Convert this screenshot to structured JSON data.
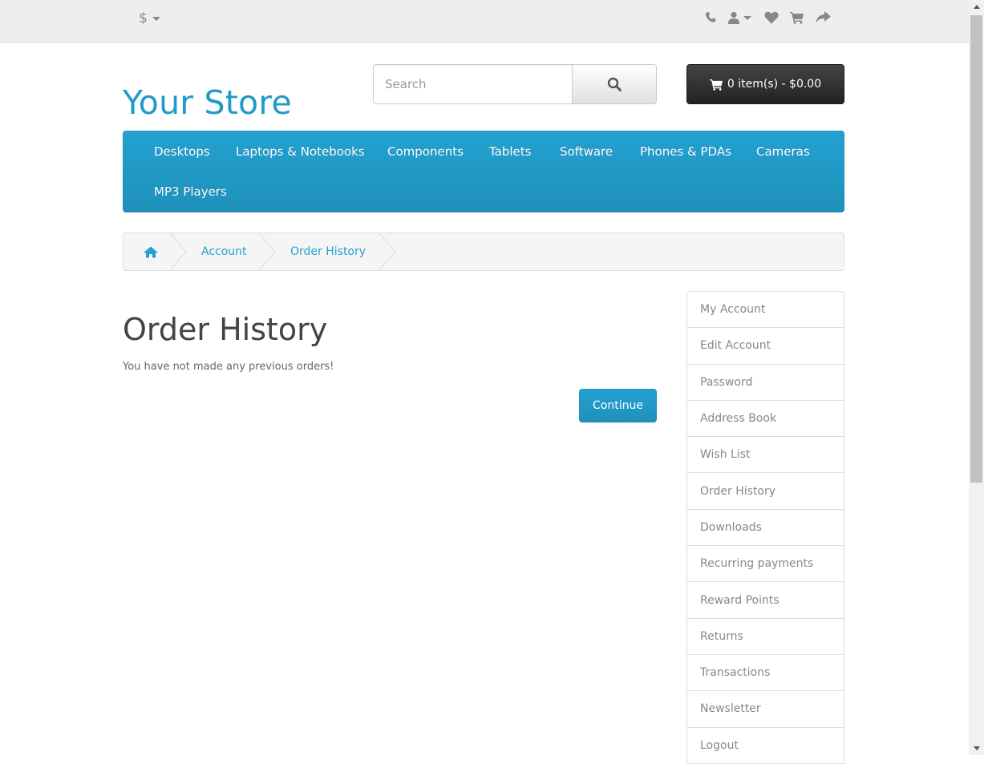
{
  "topbar": {
    "currency_symbol": "$",
    "icons": [
      "phone-icon",
      "user-icon",
      "heart-icon",
      "cart-icon",
      "share-icon"
    ]
  },
  "header": {
    "logo": "Your Store",
    "search_placeholder": "Search",
    "cart_label": "0 item(s) - $0.00"
  },
  "menu": {
    "items": [
      "Desktops",
      "Laptops & Notebooks",
      "Components",
      "Tablets",
      "Software",
      "Phones & PDAs",
      "Cameras",
      "MP3 Players"
    ]
  },
  "breadcrumb": {
    "items": [
      "Account",
      "Order History"
    ]
  },
  "content": {
    "title": "Order History",
    "empty_message": "You have not made any previous orders!",
    "continue_label": "Continue"
  },
  "sidebar": {
    "items": [
      "My Account",
      "Edit Account",
      "Password",
      "Address Book",
      "Wish List",
      "Order History",
      "Downloads",
      "Recurring payments",
      "Reward Points",
      "Returns",
      "Transactions",
      "Newsletter",
      "Logout"
    ]
  },
  "colors": {
    "accent": "#229ac8",
    "menu_bg": "#23a1d1",
    "cart_bg": "#333333",
    "topbar_bg": "#eeeeee"
  }
}
